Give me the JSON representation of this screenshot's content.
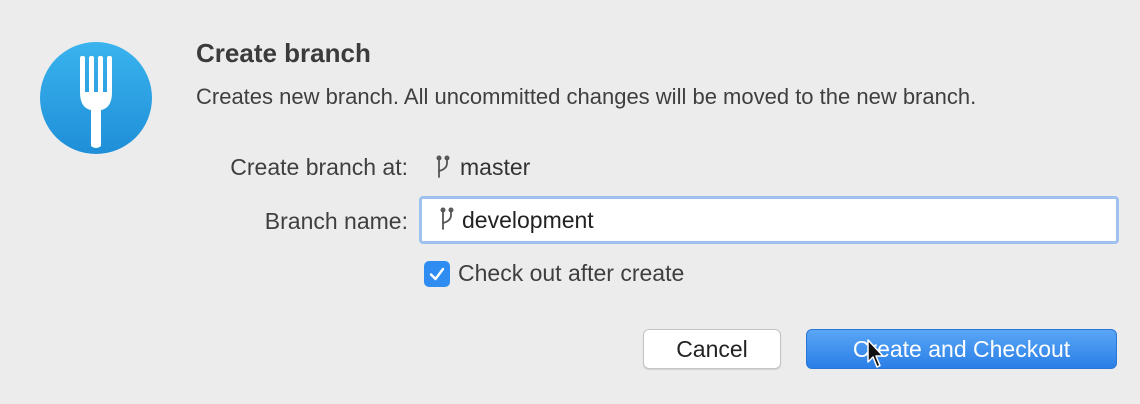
{
  "dialog": {
    "title": "Create branch",
    "subtitle": "Creates new branch. All uncommitted changes will be moved to the new branch.",
    "app_icon": "fork-icon",
    "accent_color": "#2f8cf0"
  },
  "form": {
    "create_at_label": "Create branch at:",
    "create_at_value": "master",
    "branch_name_label": "Branch name:",
    "branch_name_value": "development",
    "branch_icon": "branch-icon",
    "checkout_label": "Check out after create",
    "checkout_checked": true
  },
  "buttons": {
    "cancel_label": "Cancel",
    "primary_label": "Create and Checkout"
  }
}
